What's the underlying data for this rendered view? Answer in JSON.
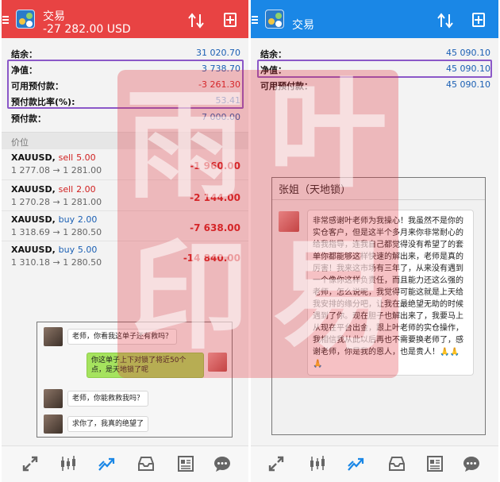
{
  "left": {
    "title": "交易",
    "balance_header": "-27 282.00 USD",
    "account": [
      {
        "label": "结余：",
        "value": "31 020.70",
        "neg": false
      },
      {
        "label": "净值：",
        "value": "3 738.70",
        "neg": false
      },
      {
        "label": "可用预付款：",
        "value": "-3 261.30",
        "neg": true
      },
      {
        "label": "预付款比率(%):",
        "value": "53.41",
        "neg": false
      },
      {
        "label": "预付款：",
        "value": "7 000.00",
        "neg": false
      }
    ],
    "section_label": "价位",
    "positions": [
      {
        "symbol": "XAUUSD,",
        "side": "sell",
        "lots": "5.00",
        "prices": "1 277.08 → 1 281.00",
        "pl": "-1 960.00"
      },
      {
        "symbol": "XAUUSD,",
        "side": "sell",
        "lots": "2.00",
        "prices": "1 270.28 → 1 281.00",
        "pl": "-2 144.00"
      },
      {
        "symbol": "XAUUSD,",
        "side": "buy",
        "lots": "2.00",
        "prices": "1 318.69 → 1 280.50",
        "pl": "-7 638.00"
      },
      {
        "symbol": "XAUUSD,",
        "side": "buy",
        "lots": "5.00",
        "prices": "1 310.18 → 1 280.50",
        "pl": "-14 840.00"
      }
    ],
    "chat": [
      "老师，你看我这单子还有救吗？",
      "你这单子上下对锁了将近50个点，是天地锁了呢",
      "老师，你能救救我吗？",
      "求你了，我真的绝望了"
    ]
  },
  "right": {
    "title": "交易",
    "account": [
      {
        "label": "结余：",
        "value": "45 090.10"
      },
      {
        "label": "净值：",
        "value": "45 090.10"
      },
      {
        "label": "可用预付款：",
        "value": "45 090.10"
      }
    ],
    "chat_name": "张姐（天地锁）",
    "chat_message": "非常感谢叶老师为我操心！我虽然不是你的实仓客户，但是这半个多月来你非常耐心的给我指导，连我自己都觉得没有希望了的套单你都能够这样快速的解出来，老师是真的厉害！我来这市场有三年了，从来没有遇到一个像你这样负责任，而且能力还这么强的老师，怎么说呢，我觉得可能这就是上天给我安排的缘分吧，让我在最绝望无助的时候遇到了你。现在胆子也解出来了，我要马上从现在平台出金，跟上叶老师的实仓操作，我相信我从此以后再也不需要换老师了，感谢老师，你是我的恩人，也是贵人！🙏🙏🙏"
  },
  "watermark": [
    "雨",
    "叶",
    "印",
    "易"
  ],
  "colors": {
    "left_bar": "#e84343",
    "right_bar": "#1a87e6",
    "highlight": "#8b58c8",
    "loss": "#d02020",
    "value": "#1a5fb4"
  },
  "nav_icons": [
    "quotes-icon",
    "chart-icon",
    "trade-icon",
    "history-icon",
    "news-icon",
    "chat-icon"
  ]
}
